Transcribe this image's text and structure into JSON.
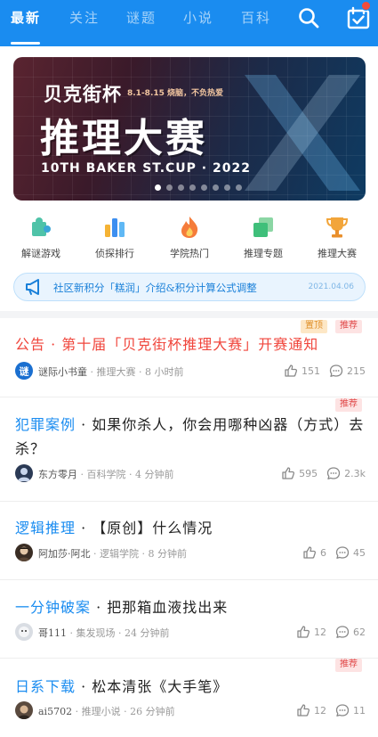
{
  "tabs": [
    "最新",
    "关注",
    "谜题",
    "小说",
    "百科"
  ],
  "banner": {
    "brand": "贝克街杯",
    "dates": "8.1-8.15 烧脑，不负热爱",
    "title": "推理大赛",
    "subtitle": "10TH BAKER ST.CUP · 2022"
  },
  "shortcuts": [
    "解谜游戏",
    "侦探排行",
    "学院热门",
    "推理专题",
    "推理大赛"
  ],
  "notice": {
    "text": "社区新积分「糕润」介绍&积分计算公式调整",
    "date": "2021.04.06"
  },
  "posts": [
    {
      "category": "公告",
      "title": "第十届「贝克街杯推理大赛」开赛通知",
      "author": "谜际小书童",
      "section": "推理大赛",
      "time": "8 小时前",
      "likes": "151",
      "comments": "215",
      "tags": [
        "置顶",
        "推荐"
      ]
    },
    {
      "category": "犯罪案例",
      "title": "如果你杀人，你会用哪种凶器（方式）去杀？",
      "author": "东方零月",
      "section": "百科学院",
      "time": "4 分钟前",
      "likes": "595",
      "comments": "2.3k",
      "tags": [
        "推荐"
      ]
    },
    {
      "category": "逻辑推理",
      "title": "【原创】什么情况",
      "author": "阿加莎·阿北",
      "section": "逻辑学院",
      "time": "8 分钟前",
      "likes": "6",
      "comments": "45",
      "tags": []
    },
    {
      "category": "一分钟破案",
      "title": "把那箱血液找出来",
      "author": "哥111",
      "section": "集发现场",
      "time": "24 分钟前",
      "likes": "12",
      "comments": "62",
      "tags": []
    },
    {
      "category": "日系下载",
      "title": "松本清张《大手笔》",
      "author": "ai5702",
      "section": "推理小说",
      "time": "26 分钟前",
      "likes": "12",
      "comments": "11",
      "tags": [
        "推荐"
      ]
    }
  ],
  "colors": {
    "primary": "#1a8cf0",
    "hot": "#f0463c",
    "top_tag": "#e0902a",
    "rec_tag": "#e04848"
  },
  "icons": [
    "search-icon",
    "checkin-icon",
    "puzzle-icon",
    "ranking-icon",
    "flame-icon",
    "topic-icon",
    "trophy-icon",
    "megaphone-icon",
    "like-icon",
    "comment-icon"
  ]
}
